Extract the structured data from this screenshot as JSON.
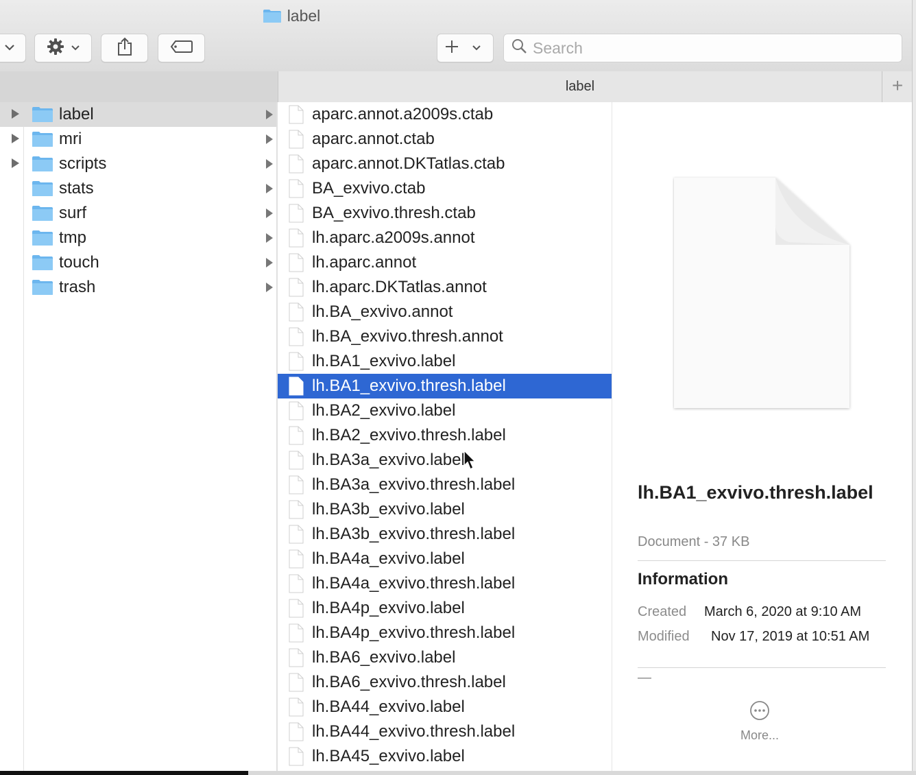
{
  "window": {
    "title": "label"
  },
  "toolbar": {
    "search_placeholder": "Search"
  },
  "column_header": {
    "title": "label"
  },
  "sidebar": {
    "folders": [
      {
        "label": "label",
        "selected": true,
        "expandable": true
      },
      {
        "label": "mri",
        "selected": false,
        "expandable": true
      },
      {
        "label": "scripts",
        "selected": false,
        "expandable": true
      },
      {
        "label": "stats",
        "selected": false,
        "expandable": false
      },
      {
        "label": "surf",
        "selected": false,
        "expandable": false
      },
      {
        "label": "tmp",
        "selected": false,
        "expandable": false
      },
      {
        "label": "touch",
        "selected": false,
        "expandable": false
      },
      {
        "label": "trash",
        "selected": false,
        "expandable": false
      }
    ]
  },
  "files": [
    "aparc.annot.a2009s.ctab",
    "aparc.annot.ctab",
    "aparc.annot.DKTatlas.ctab",
    "BA_exvivo.ctab",
    "BA_exvivo.thresh.ctab",
    "lh.aparc.a2009s.annot",
    "lh.aparc.annot",
    "lh.aparc.DKTatlas.annot",
    "lh.BA_exvivo.annot",
    "lh.BA_exvivo.thresh.annot",
    "lh.BA1_exvivo.label",
    "lh.BA1_exvivo.thresh.label",
    "lh.BA2_exvivo.label",
    "lh.BA2_exvivo.thresh.label",
    "lh.BA3a_exvivo.label",
    "lh.BA3a_exvivo.thresh.label",
    "lh.BA3b_exvivo.label",
    "lh.BA3b_exvivo.thresh.label",
    "lh.BA4a_exvivo.label",
    "lh.BA4a_exvivo.thresh.label",
    "lh.BA4p_exvivo.label",
    "lh.BA4p_exvivo.thresh.label",
    "lh.BA6_exvivo.label",
    "lh.BA6_exvivo.thresh.label",
    "lh.BA44_exvivo.label",
    "lh.BA44_exvivo.thresh.label",
    "lh.BA45_exvivo.label"
  ],
  "selected_file_index": 11,
  "preview": {
    "name": "lh.BA1_exvivo.thresh.label",
    "kind": "Document - 37 KB",
    "info_heading": "Information",
    "created_label": "Created",
    "created_value": "March 6, 2020 at 9:10 AM",
    "modified_label": "Modified",
    "modified_value": "Nov 17, 2019 at 10:51 AM",
    "tags_placeholder": "—",
    "more_label": "More..."
  },
  "colors": {
    "selection": "#2e67d3",
    "folder": "#6cb6ee"
  }
}
